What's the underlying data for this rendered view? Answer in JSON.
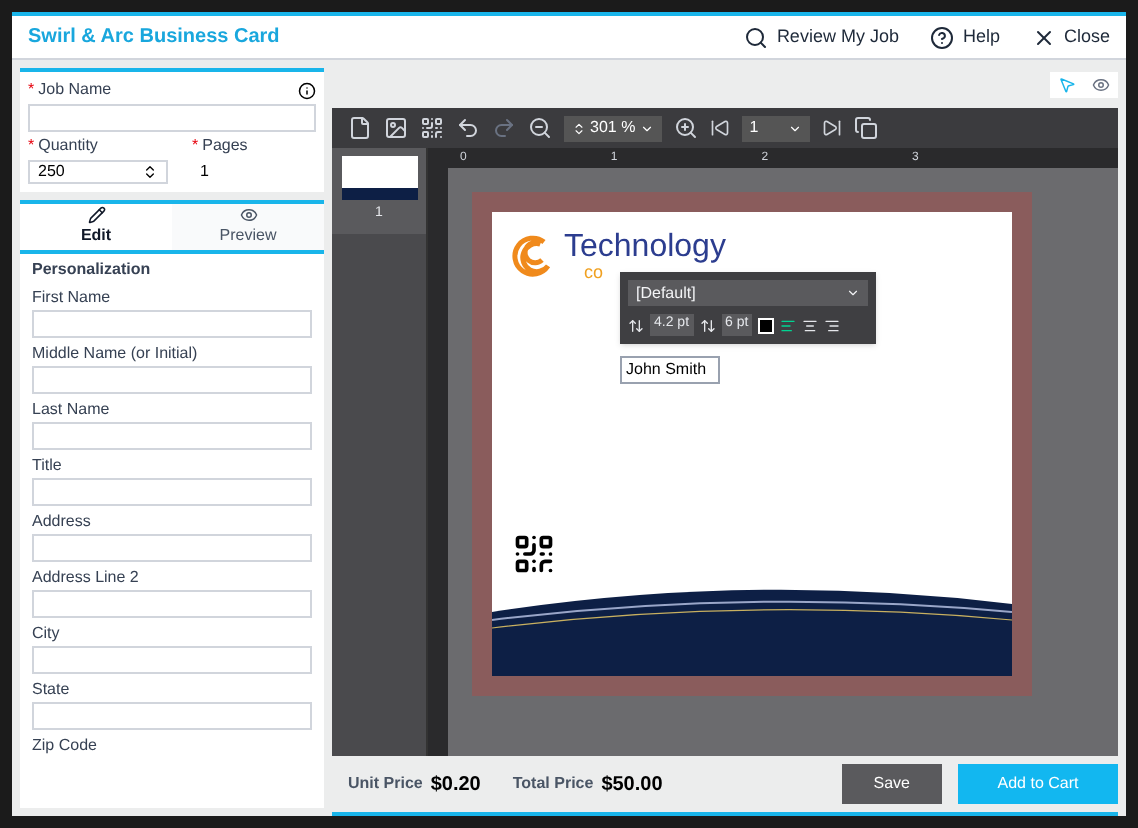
{
  "header": {
    "title": "Swirl & Arc Business Card",
    "actions": [
      {
        "kind": "review",
        "label": "Review My Job"
      },
      {
        "kind": "help",
        "label": "Help"
      },
      {
        "kind": "close",
        "label": "Close"
      }
    ]
  },
  "job": {
    "name": {
      "marker": "*",
      "label": "Job Name"
    },
    "quantity": {
      "marker": "*",
      "label": "Quantity",
      "value": "250"
    },
    "pages": {
      "marker": "*",
      "label": "Pages",
      "value": "1"
    }
  },
  "view_modes": [
    {
      "kind": "select",
      "selected": true
    },
    {
      "kind": "preview",
      "selected": false
    }
  ],
  "tabs": [
    {
      "kind": "edit",
      "label": "Edit",
      "selected": true
    },
    {
      "kind": "preview",
      "label": "Preview",
      "selected": false
    }
  ],
  "personalization": {
    "heading": "Personalization",
    "fields": [
      {
        "label": "First Name"
      },
      {
        "label": "Middle Name (or Initial)"
      },
      {
        "label": "Last Name"
      },
      {
        "label": "Title"
      },
      {
        "label": "Address"
      },
      {
        "label": "Address Line 2"
      },
      {
        "label": "City"
      },
      {
        "label": "State"
      },
      {
        "label": "Zip Code",
        "kind": "label_only"
      }
    ]
  },
  "toolbar": {
    "zoom": "301 %",
    "page": "1"
  },
  "thumbnail": {
    "label": "1"
  },
  "ruler": [
    "0",
    "1",
    "2",
    "3"
  ],
  "card": {
    "company": "Technology",
    "tagline": "co"
  },
  "text_popup": {
    "style": "[Default]",
    "tracking": "4.2 pt",
    "leading": "6 pt",
    "value": "John Smith"
  },
  "footer": {
    "unit_label": "Unit Price",
    "unit_price": "$0.20",
    "total_label": "Total Price",
    "total_price": "$50.00",
    "buttons": [
      {
        "kind": "secondary",
        "label": "Save"
      },
      {
        "kind": "primary",
        "label": "Add to Cart"
      }
    ]
  }
}
